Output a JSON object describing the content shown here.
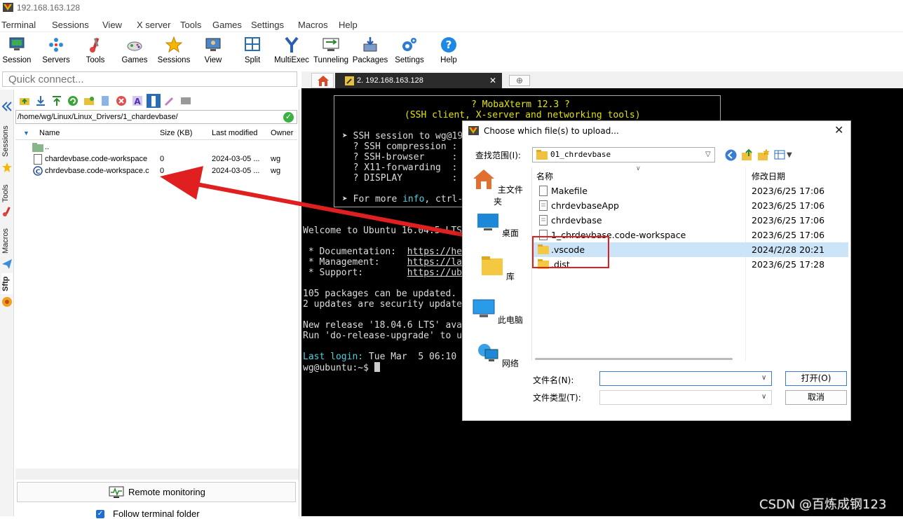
{
  "window": {
    "title": "192.168.163.128"
  },
  "menu": [
    "Terminal",
    "Sessions",
    "View",
    "X server",
    "Tools",
    "Games",
    "Settings",
    "Macros",
    "Help"
  ],
  "toolbar": [
    {
      "label": "Session",
      "icon": "session-icon"
    },
    {
      "label": "Servers",
      "icon": "servers-icon"
    },
    {
      "label": "Tools",
      "icon": "tools-icon"
    },
    {
      "label": "Games",
      "icon": "games-icon"
    },
    {
      "label": "Sessions",
      "icon": "sessions-star-icon"
    },
    {
      "label": "View",
      "icon": "view-icon"
    },
    {
      "label": "Split",
      "icon": "split-icon"
    },
    {
      "label": "MultiExec",
      "icon": "multiexec-icon"
    },
    {
      "label": "Tunneling",
      "icon": "tunneling-icon"
    },
    {
      "label": "Packages",
      "icon": "packages-icon"
    },
    {
      "label": "Settings",
      "icon": "settings-gear-icon"
    },
    {
      "label": "Help",
      "icon": "help-icon"
    }
  ],
  "quick_connect": {
    "placeholder": "Quick connect..."
  },
  "side_tabs": [
    "Sessions",
    "Tools",
    "Macros",
    "Sftp"
  ],
  "sftp": {
    "path": "/home/wg/Linux/Linux_Drivers/1_chardevbase/",
    "columns": [
      "Name",
      "Size (KB)",
      "Last modified",
      "Owner"
    ],
    "files": [
      {
        "name": "..",
        "size": "",
        "modified": "",
        "owner": "",
        "icon": "parent-folder-icon"
      },
      {
        "name": "chardevbase.code-workspace",
        "size": "0",
        "modified": "2024-03-05 ...",
        "owner": "wg",
        "icon": "file-icon"
      },
      {
        "name": "chrdevbase.code-workspace.c",
        "size": "0",
        "modified": "2024-03-05 ...",
        "owner": "wg",
        "icon": "c-file-icon"
      }
    ],
    "remote_monitoring": "Remote monitoring",
    "follow_folder": "Follow terminal folder"
  },
  "terminal_tab": {
    "label": "2. 192.168.163.128"
  },
  "terminal_lines": {
    "banner1": "? MobaXterm 12.3 ?",
    "banner2": "(SSH client, X-server and networking tools)",
    "ssh_session": "➤ SSH session to wg@19",
    "ssh_compression": "  ? SSH compression :",
    "ssh_browser": "  ? SSH-browser     :",
    "x11": "  ? X11-forwarding  :",
    "display": "  ? DISPLAY         :",
    "more_info_pre": "➤ For more ",
    "more_info_kw": "info",
    "more_info_post": ", ctrl-",
    "welcome": "Welcome to Ubuntu 16.04.5 LTS",
    "doc": " * Documentation:  ",
    "doc_url": "https://he",
    "mgmt": " * Management:     ",
    "mgmt_url": "https://la",
    "support": " * Support:        ",
    "support_url": "https://ub",
    "pkgs": "105 packages can be updated.",
    "sec": "2 updates are security update",
    "release": "New release '18.04.6 LTS' ava",
    "run": "Run 'do-release-upgrade' to u",
    "lastlogin_kw": "Last login:",
    "lastlogin": " Tue Mar  5 06:10",
    "prompt": "wg@ubuntu:~$ "
  },
  "dialog": {
    "title": "Choose which file(s) to upload...",
    "look_in_label": "查找范围(I):",
    "look_in_value": "01_chrdevbase",
    "places": [
      "主文件夹",
      "桌面",
      "库",
      "此电脑",
      "网络"
    ],
    "columns": [
      "名称",
      "修改日期"
    ],
    "files": [
      {
        "name": "Makefile",
        "date": "2023/6/25 17:06",
        "type": "file"
      },
      {
        "name": "chrdevbaseApp",
        "date": "2023/6/25 17:06",
        "type": "file"
      },
      {
        "name": "chrdevbase",
        "date": "2023/6/25 17:06",
        "type": "file"
      },
      {
        "name": "1_chrdevbase.code-workspace",
        "date": "2023/6/25 17:06",
        "type": "file"
      },
      {
        "name": ".vscode",
        "date": "2024/2/28 20:21",
        "type": "folder",
        "selected": true
      },
      {
        "name": ".dist",
        "date": "2023/6/25 17:28",
        "type": "folder"
      }
    ],
    "filename_label": "文件名(N):",
    "filetype_label": "文件类型(T):",
    "open_label": "打开(O)",
    "cancel_label": "取消"
  },
  "watermark": "CSDN @百炼成钢123",
  "colors": {
    "accent": "#3a7bd5",
    "annotation": "#e02020",
    "terminal_bg": "#000000"
  }
}
